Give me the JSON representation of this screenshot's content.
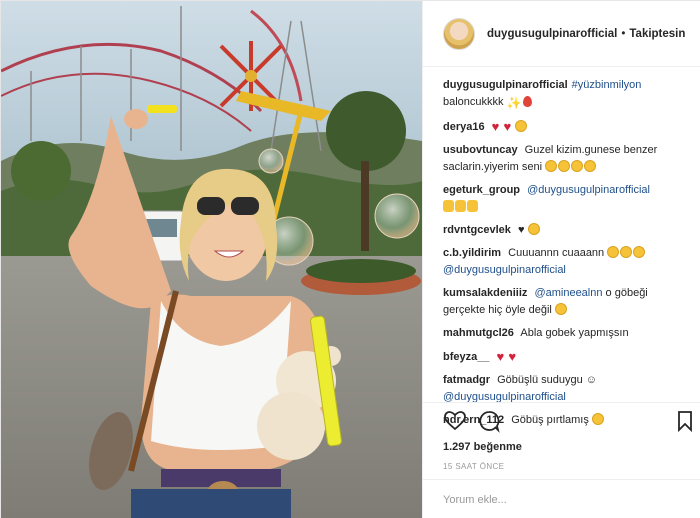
{
  "post": {
    "photo_alt": "",
    "author": "duygusugulpinarofficial",
    "separator": "•",
    "follow_label": "Takiptesin"
  },
  "caption": {
    "user": "duygusugulpinarofficial",
    "hashtag": "#yüzbinmilyon",
    "text": "baloncukkkk"
  },
  "comments": [
    {
      "user": "derya16",
      "text": ""
    },
    {
      "user": "usubovtuncay",
      "text": "Guzel kizim.gunese benzer saclarin.yiyerim seni"
    },
    {
      "user": "egeturk_group",
      "mention": "@duygusugulpinarofficial"
    },
    {
      "user": "rdvntgcevlek",
      "text": "♥"
    },
    {
      "user": "c.b.yildirim",
      "text": "Cuuuannn cuaaann",
      "mention": "@duygusugulpinarofficial"
    },
    {
      "user": "kumsalakdeniiiz",
      "mention": "@amineealnn",
      "text": "o göbeği gerçekte hiç öyle değil"
    },
    {
      "user": "mahmutgcl26",
      "text": "Abla gobek yapmışsın"
    },
    {
      "user": "bfeyza__",
      "text": ""
    },
    {
      "user": "fatmadgr",
      "text": "Göbüşlü suduygu ☺",
      "mention": "@duygusugulpinarofficial"
    },
    {
      "user": "ndr.ern_112",
      "text": "Göbüş pırtlamış"
    }
  ],
  "likes": "1.297 beğenme",
  "time": "15 SAAT ÖNCE",
  "comment_input": {
    "placeholder": "Yorum ekle..."
  },
  "icons": {
    "like": "heart-icon",
    "comment": "comment-bubble-icon",
    "save": "bookmark-icon"
  }
}
